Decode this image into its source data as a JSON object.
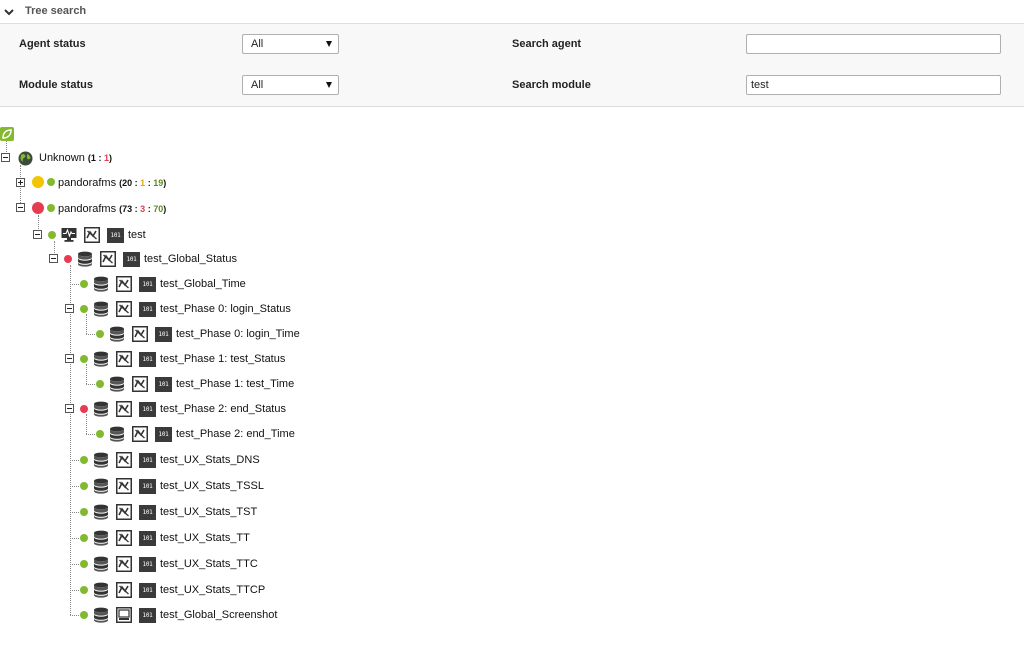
{
  "header": {
    "title": "Tree search"
  },
  "filters": {
    "agent_status_label": "Agent status",
    "agent_status_value": "All",
    "module_status_label": "Module status",
    "module_status_value": "All",
    "search_agent_label": "Search agent",
    "search_agent_value": "",
    "search_module_label": "Search module",
    "search_module_value": "test"
  },
  "tree": {
    "group": {
      "name": "Unknown",
      "count_a": "1",
      "count_b": "1"
    },
    "agents": [
      {
        "name": "pandorafms",
        "status": "yellow",
        "counts": [
          "20",
          "1",
          "19"
        ],
        "expanded": false
      },
      {
        "name": "pandorafms",
        "status": "red",
        "counts": [
          "73",
          "3",
          "70"
        ],
        "expanded": true
      }
    ],
    "modules": [
      {
        "label": "test",
        "status": "green",
        "type": "monitor-icon"
      },
      {
        "label": "test_Global_Status",
        "status": "red",
        "type": "database-icon"
      },
      {
        "label": "test_Global_Time",
        "status": "green",
        "type": "database-icon"
      },
      {
        "label": "test_Phase 0: login_Status",
        "status": "green",
        "type": "database-icon"
      },
      {
        "label": "test_Phase 0: login_Time",
        "status": "green",
        "type": "database-icon"
      },
      {
        "label": "test_Phase 1: test_Status",
        "status": "green",
        "type": "database-icon"
      },
      {
        "label": "test_Phase 1: test_Time",
        "status": "green",
        "type": "database-icon"
      },
      {
        "label": "test_Phase 2: end_Status",
        "status": "red",
        "type": "database-icon"
      },
      {
        "label": "test_Phase 2: end_Time",
        "status": "green",
        "type": "database-icon"
      },
      {
        "label": "test_UX_Stats_DNS",
        "status": "green",
        "type": "database-icon"
      },
      {
        "label": "test_UX_Stats_TSSL",
        "status": "green",
        "type": "database-icon"
      },
      {
        "label": "test_UX_Stats_TST",
        "status": "green",
        "type": "database-icon"
      },
      {
        "label": "test_UX_Stats_TT",
        "status": "green",
        "type": "database-icon"
      },
      {
        "label": "test_UX_Stats_TTC",
        "status": "green",
        "type": "database-icon"
      },
      {
        "label": "test_UX_Stats_TTCP",
        "status": "green",
        "type": "database-icon"
      },
      {
        "label": "test_Global_Screenshot",
        "status": "green",
        "type": "database-icon"
      }
    ],
    "badge_text": "101"
  },
  "colors": {
    "green": "#82b92e",
    "red": "#e63c52",
    "yellow": "#f3c500"
  }
}
